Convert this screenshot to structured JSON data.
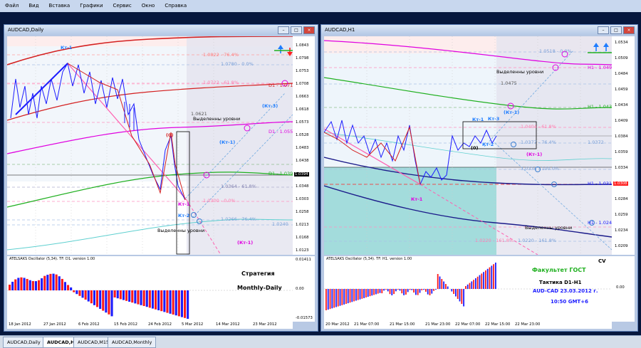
{
  "menu": [
    "Файл",
    "Вид",
    "Вставка",
    "Графики",
    "Сервис",
    "Окно",
    "Справка"
  ],
  "tabs": [
    "AUDCAD,Daily",
    "AUDCAD,H1",
    "AUDCAD,M15",
    "AUDCAD,Monthly"
  ],
  "left_window": {
    "title": "AUDCAD,Daily",
    "price_axis": [
      "1.0843",
      "1.0798",
      "1.0753",
      "1.0708",
      "1.0663",
      "1.0618",
      "1.0573",
      "1.0528",
      "1.0483",
      "1.0438",
      "1.0394",
      "1.0348",
      "1.0303",
      "1.0258",
      "1.0213",
      "1.0168",
      "1.0123"
    ],
    "price_tag": "1.0394",
    "levels": {
      "l1": "1.0822 - 76.4%",
      "l2": "1.0780 - 0.0%",
      "l3": "1.0722 - 61.8%",
      "l4": "D1 - 1.0717",
      "l5": "1.0621",
      "l6": "D1 - 1.0558",
      "l7": "D1 - 1.0398",
      "l8": "1.0364 - 61.8%",
      "l9": "1.0300 - 0.0%",
      "l10": "1.0266 - 76.4%",
      "l11": "1.0240"
    },
    "labels": {
      "kt1": "Кт-1",
      "kt1b": "(Кт-1)",
      "kt1c": "(Кт-1)",
      "kt1d": "Кт-1",
      "kt2": "Кт-2",
      "kt3": "(Кт-3)",
      "zero": "(0)",
      "levels1": "Выделенны уровни",
      "levels2": "Выделенны уровни"
    },
    "osc_title": "ATELSAKS Oscillator (5,34). TF: D1. version 1.00",
    "osc_axis": [
      "0.01411",
      "0.00",
      "-0.01573"
    ],
    "strategy_line1": "Стратегия",
    "strategy_line2": "Monthly-Daily",
    "dates": [
      "18 Jan 2012",
      "27 Jan 2012",
      "6 Feb 2012",
      "15 Feb 2012",
      "24 Feb 2012",
      "5 Mar 2012",
      "14 Mar 2012",
      "23 Mar 2012"
    ]
  },
  "right_window": {
    "title": "AUDCAD,H1",
    "price_axis": [
      "1.0534",
      "1.0509",
      "1.0484",
      "1.0459",
      "1.0434",
      "1.0409",
      "1.0384",
      "1.0359",
      "1.0334",
      "1.0309",
      "1.0284",
      "1.0259",
      "1.0234",
      "1.0209"
    ],
    "price_tag": "1.0308",
    "levels": {
      "r1": "1.0518 - 0.0%",
      "r2": "H1 - 1.0496",
      "r3": "1.0475",
      "r4": "H1 - 1.0434",
      "r5": "1.0404 - 61.8%",
      "r6": "1.0377 - 76.4%",
      "r7": "1.0372",
      "r8": "1.0334 - 100.0%",
      "r9": "H1 - 1.0310",
      "r10": "H1 - 1.0248",
      "r11": "1.0220 - 161.8%",
      "r12": "1.0220 - 161.8%"
    },
    "labels": {
      "kt1": "Кт-1",
      "kt1b": "(Кт-1)",
      "kt1c": "(Кт-1)",
      "kt1d": "Кт-1",
      "kt2": "Кт-2",
      "kt3": "Кт-3",
      "zero": "(0)",
      "levels1": "Выделенны уровни",
      "levels2": "Выделенны уровни"
    },
    "osc_title": "ATELSAKS Oscillator (5,34). TF: H1. version 1.00",
    "osc_axis": [
      "0.00"
    ],
    "cv": "CV",
    "faculty": "Факультет ГОСТ",
    "tactic": "Тактика  D1-H1",
    "pair_date": "AUD-CAD  23.03.2012 г.",
    "time": "10:50   GMT+6",
    "dates": [
      "20 Mar 2012",
      "21 Mar 07:00",
      "21 Mar 15:00",
      "21 Mar 23:00",
      "22 Mar 07:00",
      "22 Mar 15:00",
      "22 Mar 23:00"
    ]
  },
  "colors": {
    "bull": "#ff1b1b",
    "bear": "#1c1cff",
    "pink": "#ff4fb8",
    "magenta": "#e000e0"
  }
}
